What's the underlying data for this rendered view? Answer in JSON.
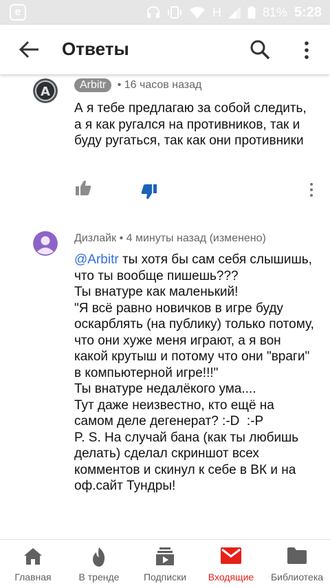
{
  "status_bar": {
    "app_icon_letter": "e",
    "network_label": "H",
    "battery": "81%",
    "time": "5:28"
  },
  "header": {
    "title": "Ответы",
    "icons": [
      "back-arrow-icon",
      "search-icon",
      "more-vertical-icon"
    ]
  },
  "comments": [
    {
      "author": "Arbitr",
      "time": "16 часов назад",
      "text": "А я тебе предлагаю за собой следить, а я как ругался на противников, так и буду ругаться, так как они противники",
      "disliked": true
    },
    {
      "author": "Дизлайк",
      "time": "4 минуты назад (изменено)",
      "mention": "@Arbitr",
      "text": " ты хотя бы сам себя слышишь, что ты вообще пишешь???\nТы внатуре как маленький!\n\"Я всё равно новичков в игре буду оскарблять (на публику) только потому, что они хуже меня играют, а я вон какой крутыш и потому что они \"враги\" в компьютерной игре!!!\"\nТы внатуре недалёкого ума....\nТут даже неизвестно, кто ещё на самом деле дегенерат? :-D  :-P\nP. S. На случай бана (как ты любишь делать) сделал скриншот всех комментов и скинул к себе в ВК и на оф.сайт Тундры!"
    }
  ],
  "bottom_nav": [
    {
      "label": "Главная",
      "icon": "home-icon"
    },
    {
      "label": "В тренде",
      "icon": "flame-icon"
    },
    {
      "label": "Подписки",
      "icon": "subscriptions-icon"
    },
    {
      "label": "Входящие",
      "icon": "inbox-icon",
      "active": true
    },
    {
      "label": "Библиотека",
      "icon": "folder-icon"
    }
  ],
  "colors": {
    "accent": "#e62117",
    "mention": "#2f6fd8",
    "status_bar": "#e6e6e6"
  }
}
